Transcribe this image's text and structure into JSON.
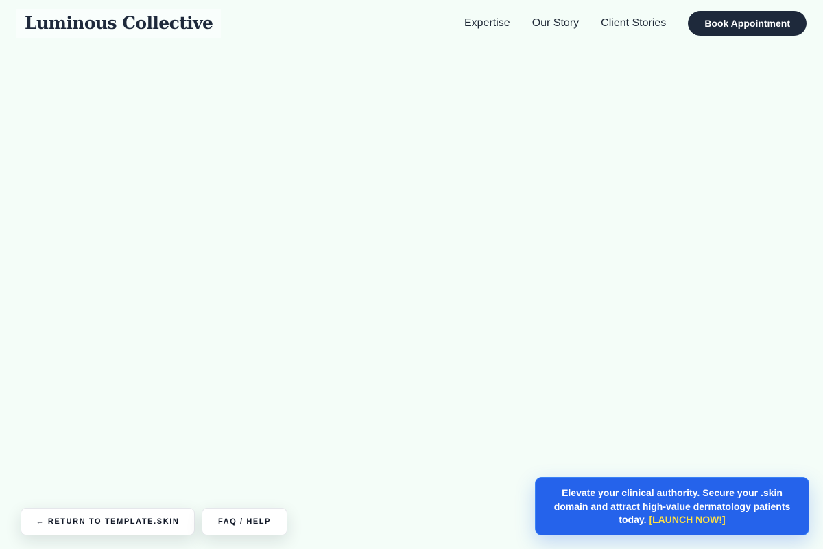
{
  "header": {
    "brand": "Luminous Collective",
    "nav": [
      {
        "label": "Expertise"
      },
      {
        "label": "Our Story"
      },
      {
        "label": "Client Stories"
      }
    ],
    "cta_label": "Book Appointment"
  },
  "floating_buttons": {
    "return_label": "← RETURN TO TEMPLATE.SKIN",
    "faq_label": "FAQ / HELP"
  },
  "promo": {
    "message": "Elevate your clinical authority. Secure your .skin domain and attract high-value dermatology patients today.",
    "cta": "[LAUNCH NOW!]"
  },
  "colors": {
    "page_background": "#f4fdf8",
    "primary_dark": "#1e293b",
    "promo_blue": "#2563eb",
    "promo_cta_yellow": "#fde047"
  }
}
